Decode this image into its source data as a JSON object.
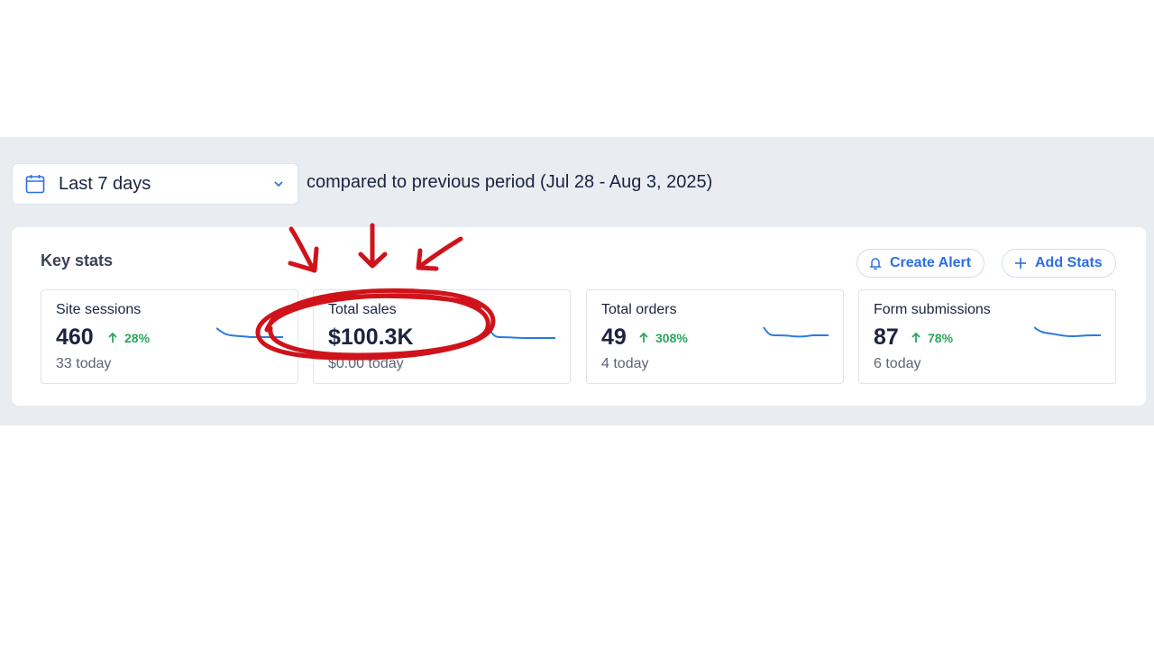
{
  "filters": {
    "date_range": "Last 7 days",
    "comparison": "compared to previous period (Jul 28 - Aug 3, 2025)"
  },
  "key_stats": {
    "title": "Key stats",
    "create_alert_label": "Create Alert",
    "add_stats_label": "Add Stats",
    "cards": [
      {
        "title": "Site sessions",
        "value": "460",
        "change": "28%",
        "sub": "33 today"
      },
      {
        "title": "Total sales",
        "value": "$100.3K",
        "change": "",
        "sub": "$0.00 today"
      },
      {
        "title": "Total orders",
        "value": "49",
        "change": "308%",
        "sub": "4 today"
      },
      {
        "title": "Form submissions",
        "value": "87",
        "change": "78%",
        "sub": "6 today"
      }
    ]
  },
  "colors": {
    "accent": "#2b6ee6",
    "positive": "#2aa65c",
    "annotation": "#d0131b",
    "band": "#e9edf2"
  },
  "icons": {
    "date": "calendar-icon",
    "dropdown": "chevron-down-icon",
    "alert": "bell-icon",
    "add": "plus-icon",
    "trend": "arrow-up-icon"
  }
}
